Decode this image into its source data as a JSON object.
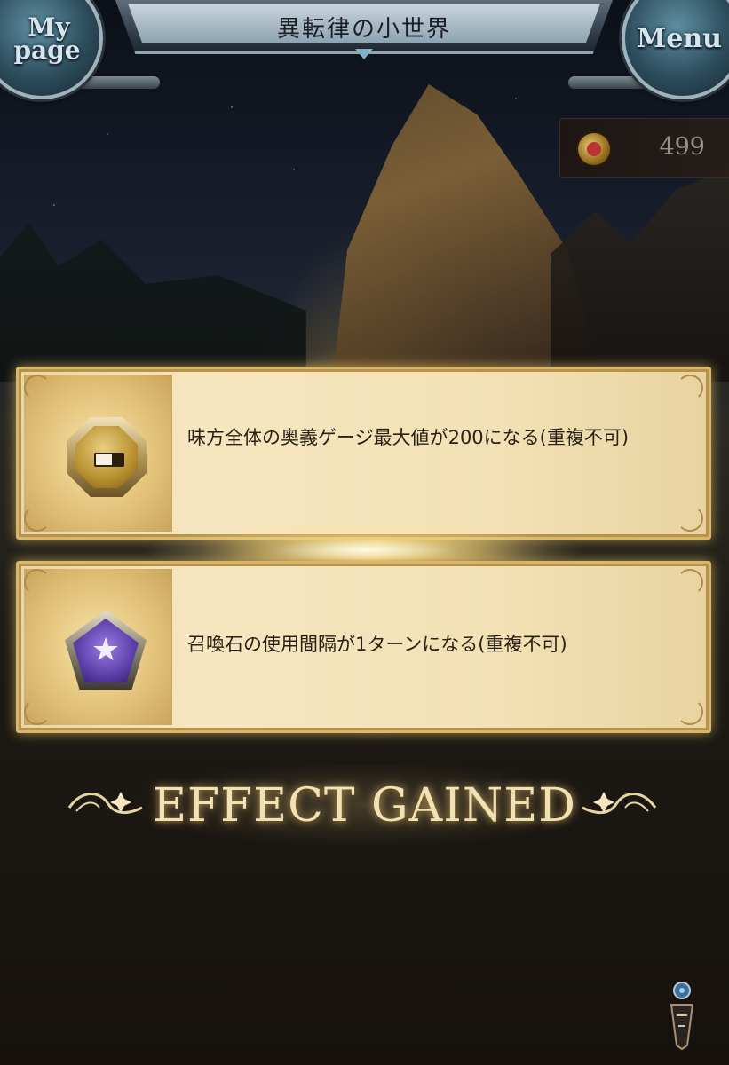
{
  "header": {
    "title": "異転律の小世界",
    "mypage_label_line1": "My",
    "mypage_label_line2": "page",
    "menu_label": "Menu"
  },
  "currency": {
    "icon": "coin-icon",
    "value": "499"
  },
  "effects": [
    {
      "icon": "ougi-gauge-icon",
      "description": "味方全体の奥義ゲージ最大値が200になる(重複不可)"
    },
    {
      "icon": "summon-star-icon",
      "description": "召喚石の使用間隔が1ターンになる(重複不可)"
    }
  ],
  "banner": {
    "text": "EFFECT GAINED"
  },
  "gauge_fill_fraction": 0.6,
  "colors": {
    "card_gold": "#f3e1b5",
    "banner_text": "#f1e2b6",
    "summon_purple": "#5a3ea8"
  }
}
